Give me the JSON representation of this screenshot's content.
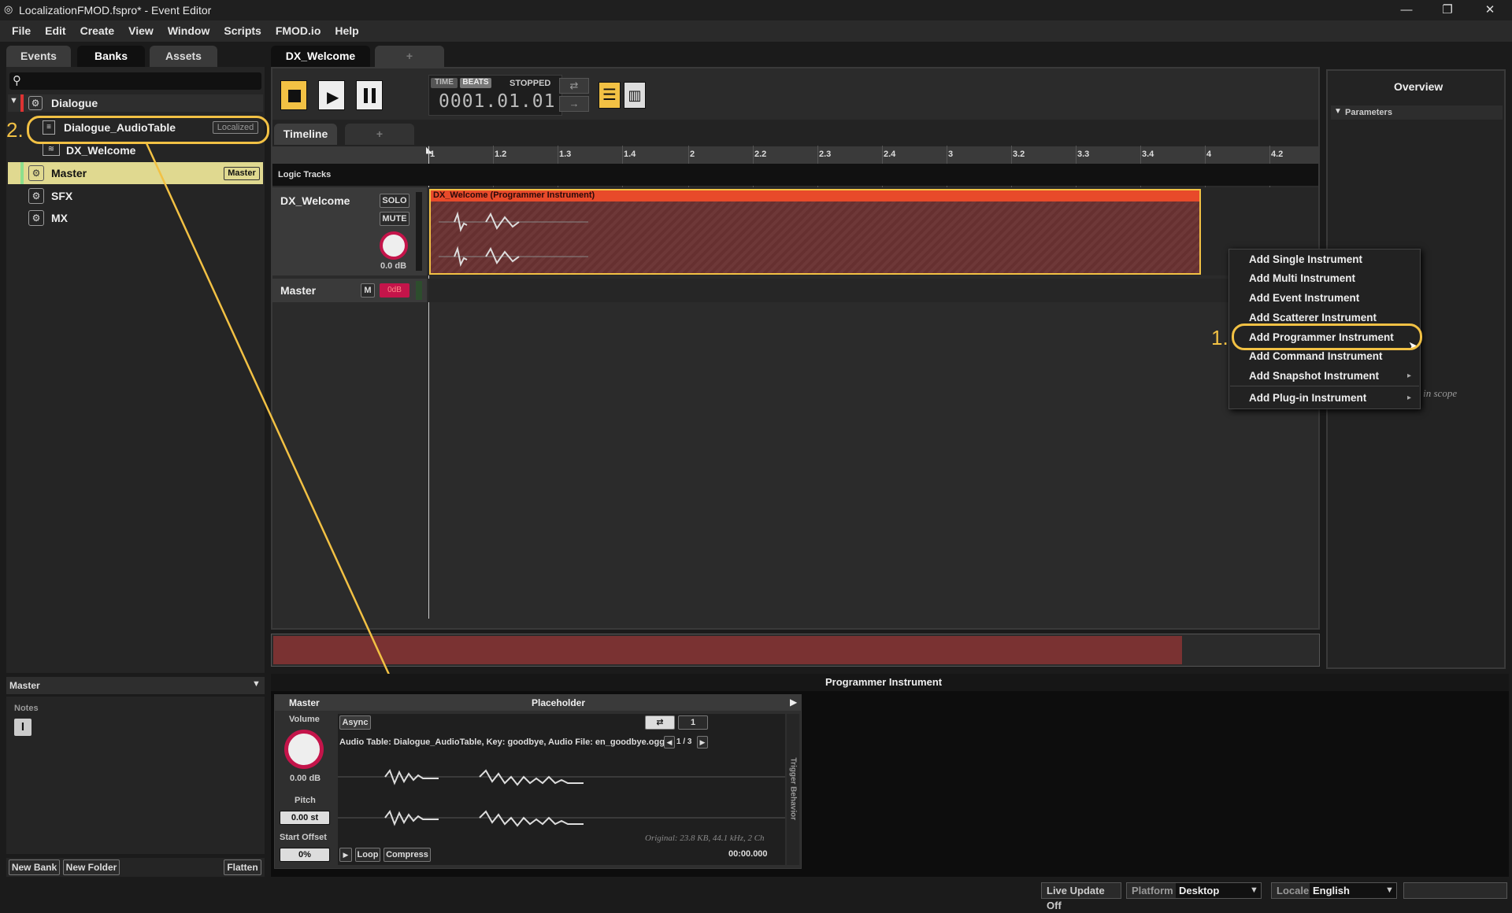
{
  "window": {
    "title": "LocalizationFMOD.fspro* - Event Editor",
    "min": "—",
    "max": "❐",
    "close": "✕"
  },
  "menu": [
    "File",
    "Edit",
    "Create",
    "View",
    "Window",
    "Scripts",
    "FMOD.io",
    "Help"
  ],
  "browser": {
    "tabs": [
      "Events",
      "Banks",
      "Assets"
    ],
    "tree": {
      "dialogue": "Dialogue",
      "audiotable": "Dialogue_AudioTable",
      "localized": "Localized",
      "dx_welcome": "DX_Welcome",
      "master": "Master",
      "master_badge": "Master",
      "sfx": "SFX",
      "mx": "MX"
    },
    "footer": {
      "new_bank": "New Bank",
      "new_folder": "New Folder",
      "flatten": "Flatten"
    },
    "props": {
      "title": "Master",
      "notes": "Notes"
    }
  },
  "event": {
    "tab": "DX_Welcome",
    "tab_add": "+",
    "transport": {
      "time": "TIME",
      "beats": "BEATS",
      "state": "STOPPED",
      "position": "0001.01.01"
    },
    "timeline_tab": "Timeline",
    "timeline_add": "+",
    "ruler": [
      "1",
      "1.2",
      "1.3",
      "1.4",
      "2",
      "2.2",
      "2.3",
      "2.4",
      "3",
      "3.2",
      "3.3",
      "3.4",
      "4",
      "4.2"
    ],
    "logic_tracks": "Logic Tracks",
    "track": {
      "name": "DX_Welcome",
      "solo": "SOLO",
      "mute": "MUTE",
      "db": "0.0 dB",
      "instrument": "DX_Welcome (Programmer Instrument)"
    },
    "master": {
      "name": "Master",
      "m": "M",
      "db": "0dB"
    }
  },
  "overview": {
    "title": "Overview",
    "parameters": "Parameters",
    "scope_text": "ers in scope"
  },
  "context_menu": {
    "items": [
      "Add Single Instrument",
      "Add Multi Instrument",
      "Add Event Instrument",
      "Add Scatterer Instrument",
      "Add Programmer Instrument",
      "Add Command Instrument",
      "Add Snapshot Instrument",
      "Add Plug-in Instrument"
    ]
  },
  "annotations": {
    "step1": "1.",
    "step2": "2."
  },
  "deck": {
    "title": "Programmer Instrument",
    "master": "Master",
    "placeholder": "Placeholder",
    "volume": "Volume",
    "volume_val": "0.00 dB",
    "pitch": "Pitch",
    "pitch_val": "0.00 st",
    "start_offset": "Start Offset",
    "offset_val": "0%",
    "async": "Async",
    "loop_count": "1",
    "page": "1 / 3",
    "audio_info": "Audio Table: Dialogue_AudioTable, Key: goodbye, Audio File: en_goodbye.ogg",
    "original": "Original: 23.8 KB, 44.1 kHz, 2 Ch",
    "loop": "Loop",
    "compress": "Compress",
    "time": "00:00.000",
    "trigger": "Trigger Behavior"
  },
  "status": {
    "live_update": "Live Update Off",
    "platform_label": "Platform",
    "platform": "Desktop",
    "locale_label": "Locale",
    "locale": "English"
  }
}
